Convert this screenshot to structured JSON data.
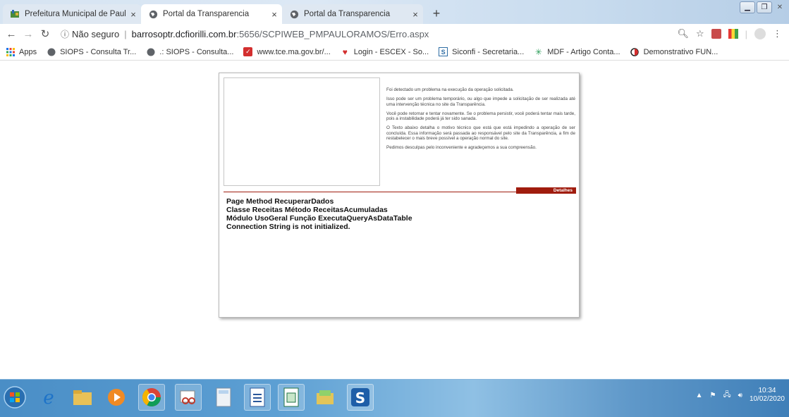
{
  "browser": {
    "tabs": [
      {
        "title": "Prefeitura Municipal de Paulo Ra",
        "close": "×"
      },
      {
        "title": "Portal da Transparencia",
        "close": "×"
      },
      {
        "title": "Portal da Transparencia",
        "close": "×"
      }
    ],
    "new_tab": "+",
    "address": {
      "security_label": "Não seguro",
      "separator": "|",
      "host": "barrosoptr.dcfiorilli.com.br",
      "path": ":5656/SCPIWEB_PMPAULORAMOS/Erro.aspx"
    },
    "bookmarks": [
      {
        "label": "Apps",
        "icon": "apps-grid-icon"
      },
      {
        "label": "SIOPS - Consulta Tr...",
        "icon": "globe-icon"
      },
      {
        "label": ".: SIOPS - Consulta...",
        "icon": "globe-icon"
      },
      {
        "label": "www.tce.ma.gov.br/...",
        "icon": "tce-icon"
      },
      {
        "label": "Login - ESCEX - So...",
        "icon": "heart-book-icon"
      },
      {
        "label": "Siconfi - Secretaria...",
        "icon": "siconfi-icon"
      },
      {
        "label": "MDF - Artigo Conta...",
        "icon": "mdf-icon"
      },
      {
        "label": "Demonstrativo FUN...",
        "icon": "red-circle-icon"
      }
    ]
  },
  "error_page": {
    "messages": [
      "Foi detectado um problema na execução da operação solicitada.",
      "Isso pode ser um problema temporário, ou algo que impede a solicitação de ser realizada até uma intervenção técnica no site da Transparência.",
      "Você pode retornar e tentar novamente. Se o problema persistir, você poderá tentar mais tarde, pois a instabilidade poderá já ter sido sanada.",
      "O Texto abaixo detalha o motivo técnico que está que está impedindo a operação de ser concluída. Essa informação será passada ao responsável pelo site da Transparência, a fim de restabelecer o mais breve possível a operação normal do site.",
      "Pedimos desculpas pelo inconveniente e agradeçemos a sua compreensão."
    ],
    "details_label": "Detalhes",
    "details_lines": [
      "Page Method RecuperarDados",
      "Classe Receitas Método ReceitasAcumuladas",
      "Módulo UsoGeral Função ExecutaQueryAsDataTable",
      "Connection String is not initialized."
    ],
    "accent_color": "#a01c0e"
  },
  "taskbar": {
    "time": "10:34",
    "date": "10/02/2020"
  }
}
